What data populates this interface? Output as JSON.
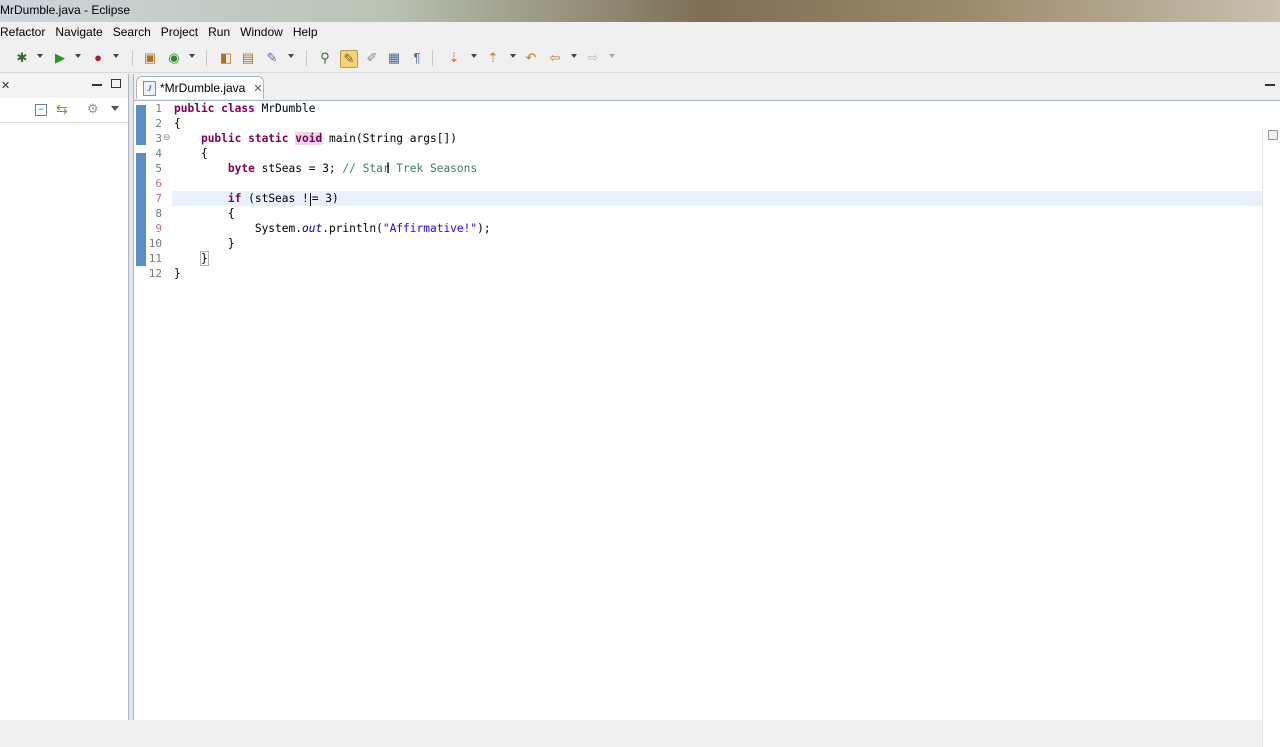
{
  "window": {
    "title": "MrDumble.java - Eclipse"
  },
  "menu": [
    "Refactor",
    "Navigate",
    "Search",
    "Project",
    "Run",
    "Window",
    "Help"
  ],
  "toolbar": {
    "icons": [
      "debug-icon",
      "run-icon",
      "external-tools-icon",
      "new-java-project-icon",
      "new-class-icon",
      "open-type-icon",
      "open-task-icon",
      "search-icon",
      "toggle-breadcrumb-icon",
      "toggle-mark-occurrences-icon",
      "block-selection-icon",
      "show-whitespace-icon",
      "next-annotation-icon",
      "previous-annotation-icon",
      "last-edit-icon",
      "back-icon",
      "forward-icon"
    ]
  },
  "left_panel": {
    "close_glyph": "✕"
  },
  "editor": {
    "tab_title": "*MrDumble.java",
    "tab_close": "✕",
    "line_numbers": [
      "1",
      "2",
      "3",
      "4",
      "5",
      "6",
      "7",
      "8",
      "9",
      "10",
      "11",
      "12"
    ],
    "lines": {
      "l1_kw": "public class",
      "l1_rest": " MrDumble",
      "l2": "{",
      "l3_kw": "public static",
      "l3_void": "void",
      "l3_rest": " main(String args[])",
      "l4": "{",
      "l5_kw": "byte",
      "l5_rest": " stSeas = 3; ",
      "l5_comment": "// Star Trek Seasons",
      "l7_kw": "if",
      "l7_a": " (stSeas !",
      "l7_b": "= 3)",
      "l8": "{",
      "l9_a": "System.",
      "l9_out": "out",
      "l9_b": ".println(",
      "l9_str": "\"Affirmative!\"",
      "l9_c": ");",
      "l10": "}",
      "l11": "}",
      "l12": "}"
    }
  }
}
